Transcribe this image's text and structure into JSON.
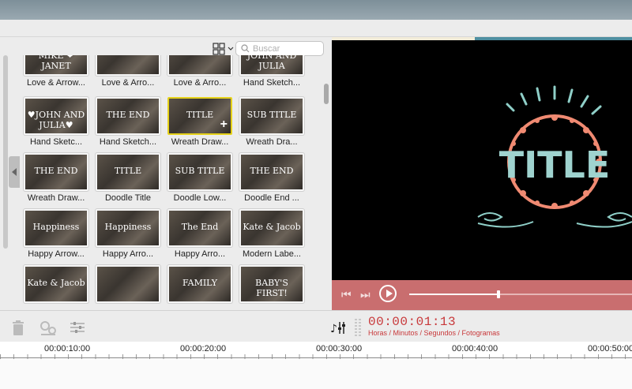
{
  "search": {
    "placeholder": "Buscar"
  },
  "grid": {
    "tiles": [
      {
        "label": "Love & Arrow...",
        "thumb": "MIKE ❤ JANET"
      },
      {
        "label": "Love & Arro...",
        "thumb": ""
      },
      {
        "label": "Love & Arro...",
        "thumb": ""
      },
      {
        "label": "Hand Sketch...",
        "thumb": "JOHN AND JULIA"
      },
      {
        "label": "Hand Sketc...",
        "thumb": "♥JOHN AND JULIA♥"
      },
      {
        "label": "Hand Sketch...",
        "thumb": "THE END"
      },
      {
        "label": "Wreath Draw...",
        "thumb": "TITLE"
      },
      {
        "label": "Wreath Dra...",
        "thumb": "SUB TITLE"
      },
      {
        "label": "Wreath Draw...",
        "thumb": "THE END"
      },
      {
        "label": "Doodle Title",
        "thumb": "TITLE"
      },
      {
        "label": "Doodle Low...",
        "thumb": "SUB TITLE"
      },
      {
        "label": "Doodle End ...",
        "thumb": "THE END"
      },
      {
        "label": "Happy Arrow...",
        "thumb": "Happiness"
      },
      {
        "label": "Happy Arro...",
        "thumb": "Happiness"
      },
      {
        "label": "Happy Arro...",
        "thumb": "The End"
      },
      {
        "label": "Modern Labe...",
        "thumb": "Kate & Jacob"
      },
      {
        "label": "",
        "thumb": "Kate & Jacob"
      },
      {
        "label": "",
        "thumb": ""
      },
      {
        "label": "",
        "thumb": "FAMILY"
      },
      {
        "label": "",
        "thumb": "BABY'S FIRST!"
      }
    ]
  },
  "preview": {
    "title_text": "TITLE"
  },
  "player": {
    "seek_progress": 0.4
  },
  "timecode": {
    "value": "00:00:01:13",
    "subtitle": "Horas / Minutos / Segundos / Fotogramas"
  },
  "ruler": {
    "labels": [
      "00:00:10:00",
      "00:00:20:00",
      "00:00:30:00",
      "00:00:40:00",
      "00:00:50:00"
    ]
  },
  "colors": {
    "accent": "#c96e6f",
    "timecode": "#c8383a",
    "selection": "#e6d21a",
    "wreath": "#f08a72",
    "title_text": "#9fd3cf"
  }
}
